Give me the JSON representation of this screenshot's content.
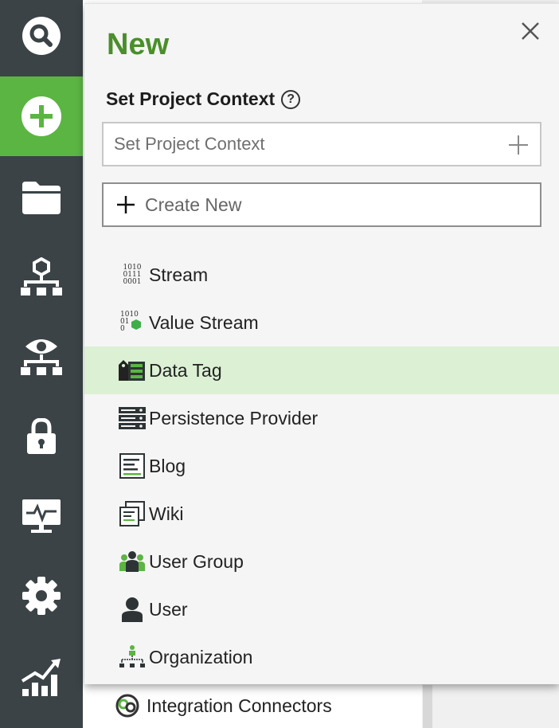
{
  "nav": {
    "items": [
      {
        "icon": "search-icon",
        "active": false
      },
      {
        "icon": "add-circle-icon",
        "active": true
      },
      {
        "icon": "folder-icon",
        "active": false
      },
      {
        "icon": "hierarchy-icon",
        "active": false
      },
      {
        "icon": "eye-hierarchy-icon",
        "active": false
      },
      {
        "icon": "lock-icon",
        "active": false
      },
      {
        "icon": "monitor-pulse-icon",
        "active": false
      },
      {
        "icon": "gear-icon",
        "active": false
      },
      {
        "icon": "chart-trend-icon",
        "active": false
      }
    ]
  },
  "panel": {
    "title": "New",
    "context_label": "Set Project Context",
    "context_placeholder": "Set Project Context",
    "create_new_label": "Create New",
    "items": [
      {
        "label": "Stream",
        "icon": "binary-stream-icon",
        "highlighted": false
      },
      {
        "label": "Value Stream",
        "icon": "value-stream-icon",
        "highlighted": false
      },
      {
        "label": "Data Tag",
        "icon": "data-tag-icon",
        "highlighted": true
      },
      {
        "label": "Persistence Provider",
        "icon": "server-icon",
        "highlighted": false
      },
      {
        "label": "Blog",
        "icon": "blog-icon",
        "highlighted": false
      },
      {
        "label": "Wiki",
        "icon": "wiki-icon",
        "highlighted": false
      },
      {
        "label": "User Group",
        "icon": "user-group-icon",
        "highlighted": false
      },
      {
        "label": "User",
        "icon": "user-icon",
        "highlighted": false
      },
      {
        "label": "Organization",
        "icon": "organization-icon",
        "highlighted": false
      }
    ]
  },
  "background": {
    "item_label": "Integration Connectors"
  },
  "colors": {
    "accent_green": "#5bb543",
    "title_green": "#4a8f2a",
    "rail_bg": "#3b4346",
    "highlight_bg": "#dcf0d4"
  }
}
